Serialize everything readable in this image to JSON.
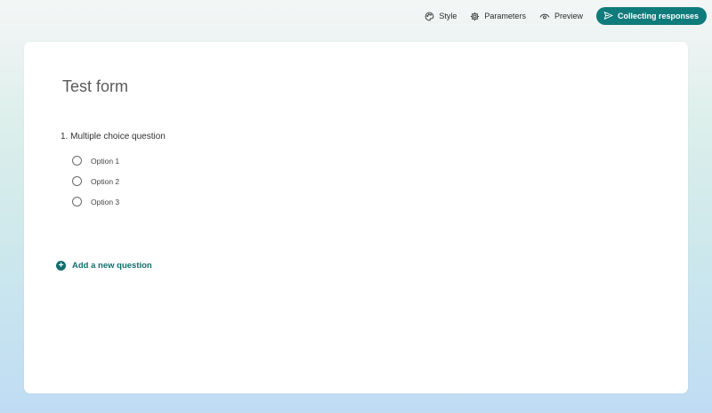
{
  "toolbar": {
    "style_label": "Style",
    "parameters_label": "Parameters",
    "preview_label": "Preview",
    "collect_label": "Collecting responses",
    "accent_color": "#0f7b7b"
  },
  "form": {
    "title": "Test form",
    "questions": [
      {
        "title": "1. Multiple choice question",
        "options": [
          "Option 1",
          "Option 2",
          "Option 3"
        ]
      }
    ],
    "add_question_label": "Add a new question"
  },
  "icons": {
    "style": "palette-icon",
    "parameters": "gear-icon",
    "preview": "eye-icon",
    "collect": "send-icon",
    "add": "plus-circle-icon"
  }
}
